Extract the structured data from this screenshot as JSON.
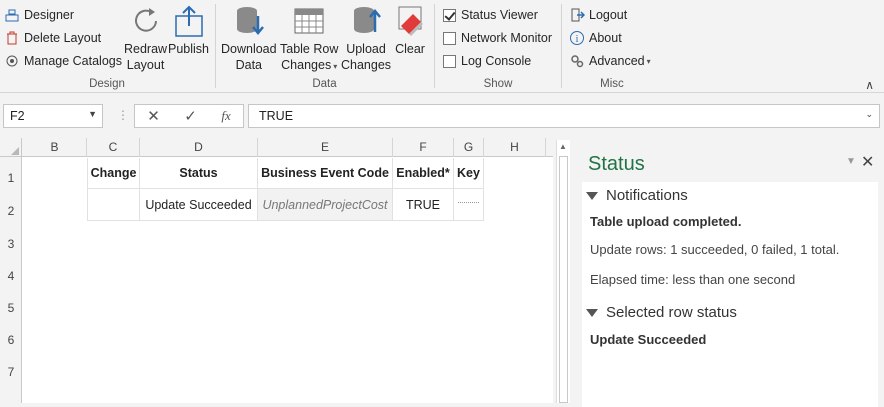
{
  "ribbon": {
    "design": {
      "label": "Design",
      "designer": "Designer",
      "delete_layout": "Delete Layout",
      "manage_catalogs": "Manage Catalogs",
      "redraw_line1": "Redraw",
      "redraw_line2": "Layout",
      "publish": "Publish"
    },
    "data": {
      "label": "Data",
      "download_line1": "Download",
      "download_line2": "Data",
      "tablerow_line1": "Table Row",
      "tablerow_line2": "Changes",
      "upload_line1": "Upload",
      "upload_line2": "Changes",
      "clear": "Clear"
    },
    "show": {
      "label": "Show",
      "status_viewer": "Status Viewer",
      "network_monitor": "Network Monitor",
      "log_console": "Log Console"
    },
    "misc": {
      "label": "Misc",
      "logout": "Logout",
      "about": "About",
      "advanced": "Advanced"
    }
  },
  "formula_bar": {
    "name_box": "F2",
    "value": "TRUE",
    "fx": "fx"
  },
  "grid": {
    "columns": [
      "B",
      "C",
      "D",
      "E",
      "F",
      "G",
      "H"
    ],
    "rows": [
      "1",
      "2",
      "3",
      "4",
      "5",
      "6",
      "7"
    ],
    "headers": {
      "change": "Change",
      "status": "Status",
      "business_event_code": "Business Event Code",
      "enabled": "Enabled*",
      "key": "Key"
    },
    "row2": {
      "change": "",
      "status": "Update Succeeded",
      "business_event_code": "UnplannedProjectCost",
      "enabled": "TRUE"
    }
  },
  "status_pane": {
    "title": "Status",
    "notifications": {
      "heading": "Notifications",
      "message": "Table upload completed.",
      "update_rows": "Update rows:  1 succeeded, 0 failed, 1 total.",
      "elapsed": "Elapsed time: less than one second"
    },
    "selected_row": {
      "heading": "Selected row status",
      "value": "Update Succeeded"
    }
  },
  "colors": {
    "accent_green": "#217346",
    "clear_red": "#e03a3a",
    "icon_blue": "#2b6cb0"
  }
}
